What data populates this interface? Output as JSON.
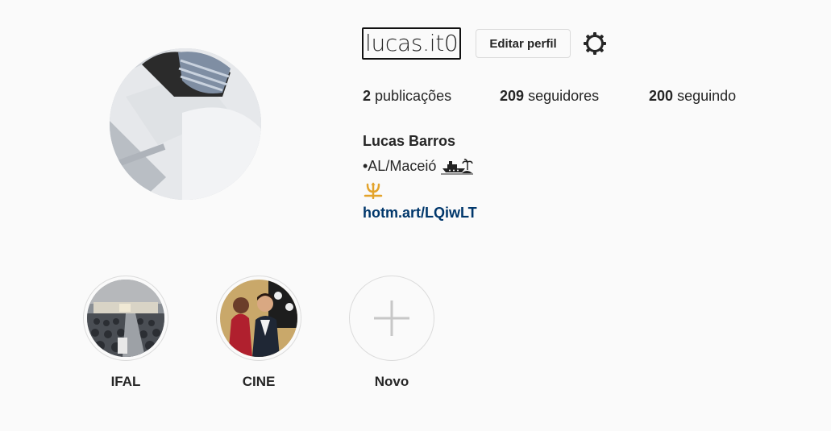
{
  "profile": {
    "username": "lucas.it0",
    "edit_button": "Editar perfil",
    "settings_icon": "gear-icon",
    "stats": {
      "posts_count": "2",
      "posts_label": "publicações",
      "followers_count": "209",
      "followers_label": "seguidores",
      "following_count": "200",
      "following_label": "seguindo"
    },
    "full_name": "Lucas Barros",
    "location": "•AL/Maceió",
    "location_emoji": "ship-and-island-emoji",
    "trident_emoji": "trident-emoji",
    "link": "hotm.art/LQiwLT"
  },
  "highlights": [
    {
      "label": "IFAL"
    },
    {
      "label": "CINE"
    },
    {
      "label": "Novo"
    }
  ],
  "colors": {
    "background": "#fafafa",
    "text": "#262626",
    "link": "#00376b",
    "border": "#dbdbdb"
  }
}
